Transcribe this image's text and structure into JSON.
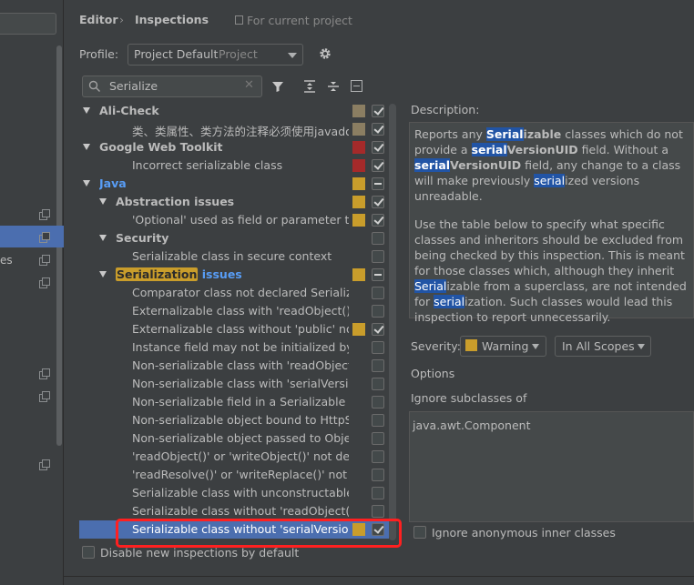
{
  "header": {
    "breadcrumb_editor": "Editor",
    "breadcrumb_sep": "›",
    "breadcrumb_inspections": "Inspections",
    "scope_note": "For current project"
  },
  "left_panel": {
    "partial_label": "es"
  },
  "profile": {
    "label": "Profile:",
    "name": "Project Default",
    "sub": "Project"
  },
  "search": {
    "value": "Serialize"
  },
  "tree": [
    {
      "text": "Ali-Check",
      "level": 0,
      "expanded": true,
      "bold": true,
      "color_swatch": "#8b7e62",
      "check": "checked"
    },
    {
      "text": "类、类属性、类方法的注释必须使用javadoc规范",
      "level": 2,
      "color_swatch": "#8b7e62",
      "check": "checked"
    },
    {
      "text": "Google Web Toolkit",
      "level": 0,
      "expanded": true,
      "bold": true,
      "color_swatch": "#a52a2a",
      "check": "checked"
    },
    {
      "text": "Incorrect serializable class",
      "level": 2,
      "color_swatch": "#a52a2a",
      "check": "checked"
    },
    {
      "text": "Java",
      "level": 0,
      "expanded": true,
      "bold": true,
      "blue": true,
      "color_swatch": "#c99d2b",
      "check": "mixed"
    },
    {
      "text": "Abstraction issues",
      "level": 1,
      "expanded": true,
      "bold": true,
      "color_swatch": "#c99d2b",
      "check": "checked"
    },
    {
      "text": "'Optional' used as field or parameter type",
      "level": 2,
      "color_swatch": "#c99d2b",
      "check": "checked"
    },
    {
      "text": "Security",
      "level": 1,
      "expanded": true,
      "bold": true,
      "check": "unchecked"
    },
    {
      "text": "Serializable class in secure context",
      "level": 2,
      "check": "unchecked"
    },
    {
      "text": "Serialization",
      "suffix": " issues",
      "level": 1,
      "expanded": true,
      "bold": true,
      "blue": true,
      "highlight": true,
      "color_swatch": "#c99d2b",
      "check": "mixed"
    },
    {
      "text": "Comparator class not declared Serializable",
      "level": 2,
      "check": "unchecked"
    },
    {
      "text": "Externalizable class with 'readObject()' or",
      "level": 2,
      "check": "unchecked"
    },
    {
      "text": "Externalizable class without 'public' no-arg",
      "level": 2,
      "color_swatch": "#c99d2b",
      "check": "checked"
    },
    {
      "text": "Instance field may not be initialized by 're",
      "level": 2,
      "check": "unchecked"
    },
    {
      "text": "Non-serializable class with 'readObject()'",
      "level": 2,
      "check": "unchecked"
    },
    {
      "text": "Non-serializable class with 'serialVersionU",
      "level": 2,
      "check": "unchecked"
    },
    {
      "text": "Non-serializable field in a Serializable cla",
      "level": 2,
      "check": "unchecked"
    },
    {
      "text": "Non-serializable object bound to HttpSes",
      "level": 2,
      "check": "unchecked"
    },
    {
      "text": "Non-serializable object passed to Object",
      "level": 2,
      "check": "unchecked"
    },
    {
      "text": "'readObject()' or 'writeObject()' not decla",
      "level": 2,
      "check": "unchecked"
    },
    {
      "text": "'readResolve()' or 'writeReplace()' not dec",
      "level": 2,
      "check": "unchecked"
    },
    {
      "text": "Serializable class with unconstructable an",
      "level": 2,
      "check": "unchecked"
    },
    {
      "text": "Serializable class without 'readObject()' a",
      "level": 2,
      "check": "unchecked"
    },
    {
      "text": "Serializable class without 'serialVersionUI",
      "level": 2,
      "selected": true,
      "color_swatch": "#c99d2b",
      "check": "checked"
    }
  ],
  "disable_new": {
    "label": "Disable new inspections by default"
  },
  "description": {
    "label": "Description:",
    "p1": [
      "Reports any ",
      {
        "h": "Serial",
        "b": true
      },
      {
        "t": "izable",
        "b": true
      },
      " classes which do not provide a ",
      {
        "h": "serial",
        "b": true
      },
      {
        "t": "VersionUID",
        "b": true
      },
      " field. Without a ",
      {
        "h": "serial",
        "b": true
      },
      {
        "t": "VersionUID",
        "b": true
      },
      " field, any change to a class will make previously ",
      {
        "h": "serial"
      },
      "ized versions unreadable."
    ],
    "p2": [
      "Use the table below to specify what specific classes and inheritors should be excluded from being checked by this inspection. This is meant for those classes which, although they inherit ",
      {
        "h": "Serial"
      },
      "izable from a superclass, are not intended for ",
      {
        "h": "serial"
      },
      "ization. Such classes would lead this inspection to report unnecessarily."
    ]
  },
  "severity": {
    "label": "Severity:",
    "value": "Warning",
    "color": "#c99d2b",
    "scope": "In All Scopes"
  },
  "options": {
    "label": "Options",
    "ignore_label": "Ignore subclasses of",
    "ignore_value": "java.awt.Component",
    "anon_label": "Ignore anonymous inner classes"
  }
}
